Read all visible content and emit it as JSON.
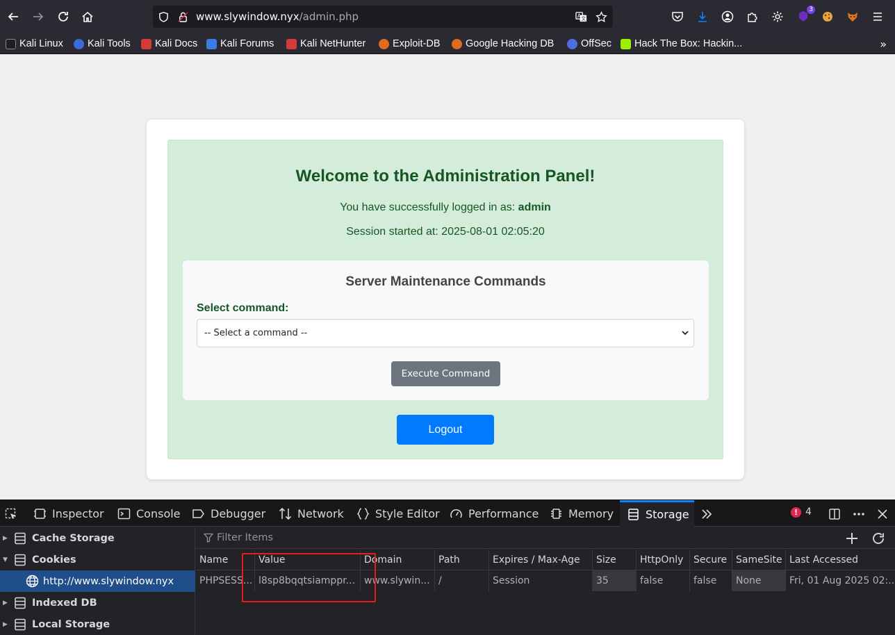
{
  "browser": {
    "url_host": "www.slywindow.nyx",
    "url_path": "/admin.php",
    "extension_badge": "3"
  },
  "bookmarks": [
    {
      "label": "Kali Linux",
      "color": "#1f1f1f"
    },
    {
      "label": "Kali Tools",
      "color": "#3c6bd8"
    },
    {
      "label": "Kali Docs",
      "color": "#d33b3b"
    },
    {
      "label": "Kali Forums",
      "color": "#3b7de0"
    },
    {
      "label": "Kali NetHunter",
      "color": "#d33b3b"
    },
    {
      "label": "Exploit-DB",
      "color": "#e06a1d"
    },
    {
      "label": "Google Hacking DB",
      "color": "#e06a1d"
    },
    {
      "label": "OffSec",
      "color": "#4f6fe0"
    },
    {
      "label": "Hack The Box: Hackin...",
      "color": "#9fef00"
    }
  ],
  "page": {
    "welcome_title": "Welcome to the Administration Panel!",
    "logged_in_prefix": "You have successfully logged in as: ",
    "logged_in_user": "admin",
    "session_text": "Session started at: 2025-08-01 02:05:20",
    "maintenance_title": "Server Maintenance Commands",
    "select_label": "Select command:",
    "select_value": "-- Select a command --",
    "execute_label": "Execute Command",
    "logout_label": "Logout"
  },
  "devtools": {
    "tabs": [
      "Inspector",
      "Console",
      "Debugger",
      "Network",
      "Style Editor",
      "Performance",
      "Memory",
      "Storage"
    ],
    "active_tab": "Storage",
    "error_count": "4",
    "error_icon": "!",
    "tree": [
      {
        "label": "Cache Storage",
        "expanded": false
      },
      {
        "label": "Cookies",
        "expanded": true
      },
      {
        "label": "http://www.slywindow.nyx",
        "selected": true
      },
      {
        "label": "Indexed DB",
        "expanded": false
      },
      {
        "label": "Local Storage",
        "expanded": false
      }
    ],
    "filter_placeholder": "Filter Items",
    "columns": [
      "Name",
      "Value",
      "Domain",
      "Path",
      "Expires / Max-Age",
      "Size",
      "HttpOnly",
      "Secure",
      "SameSite",
      "Last Accessed"
    ],
    "row": [
      "PHPSESS...",
      "l8sp8bqqtsiamppr...",
      "www.slywin...",
      "/",
      "Session",
      "35",
      "false",
      "false",
      "None",
      "Fri, 01 Aug 2025 02:..."
    ]
  },
  "colors": {
    "panel_bg": "#d4edda",
    "panel_text": "#155724",
    "execute_bg": "#6c757d",
    "logout_bg": "#007bff",
    "highlight_box": "#e02020",
    "devtools_accent": "#0a84ff"
  }
}
